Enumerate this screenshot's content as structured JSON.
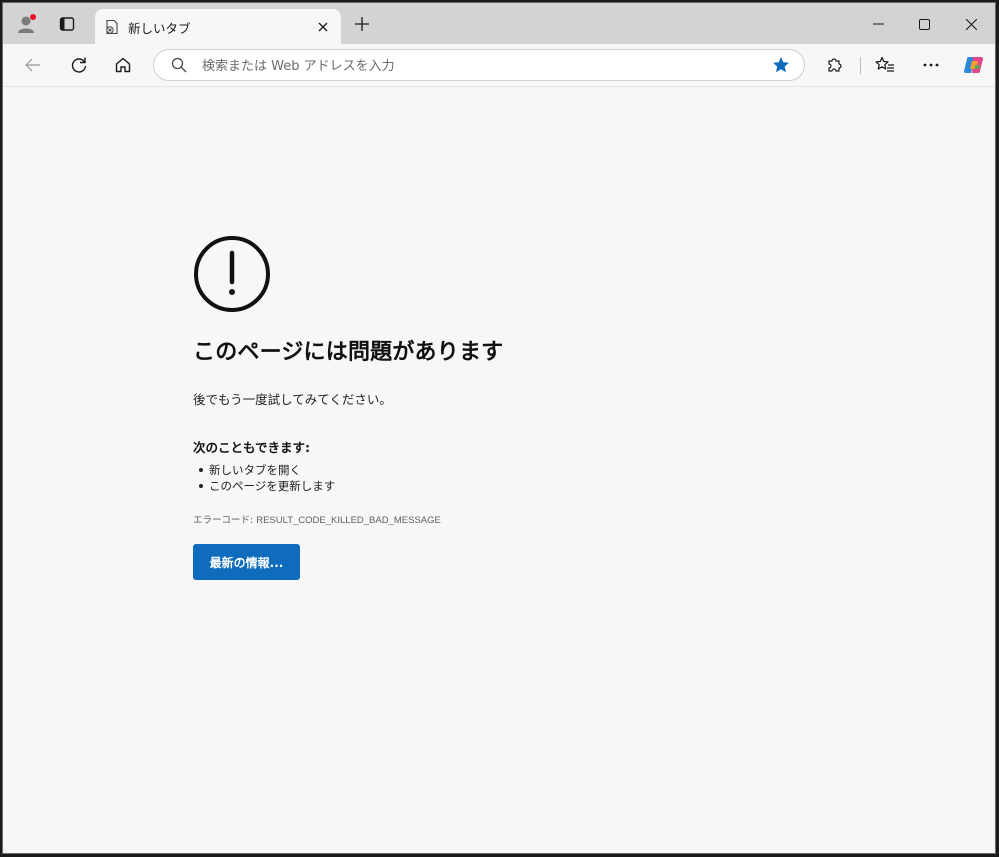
{
  "browser": {
    "tab": {
      "title": "新しいタブ"
    },
    "address_bar": {
      "placeholder": "検索または Web アドレスを入力"
    }
  },
  "error_page": {
    "heading": "このページには問題があります",
    "message": "後でもう一度試してみてください。",
    "suggestions_title": "次のこともできます:",
    "suggestions": [
      "新しいタブを開く",
      "このページを更新します"
    ],
    "error_code_label": "エラーコード: ",
    "error_code": "RESULT_CODE_KILLED_BAD_MESSAGE",
    "details_button": "最新の情報..."
  },
  "icons": {
    "profile": "profile-icon",
    "workspaces": "tab-actions-icon",
    "new_tab": "plus-icon",
    "back": "back-arrow-icon",
    "refresh": "refresh-icon",
    "home": "home-icon",
    "search": "search-icon",
    "favorite": "star-icon",
    "extensions": "extensions-icon",
    "favorites": "favorites-icon",
    "more": "more-icon",
    "copilot": "copilot-icon",
    "warning": "warning-circle-icon"
  },
  "colors": {
    "accent": "#0f6cbd",
    "star": "#0f6cbd",
    "profile_badge": "#e81123",
    "background": "#f7f7f7"
  }
}
